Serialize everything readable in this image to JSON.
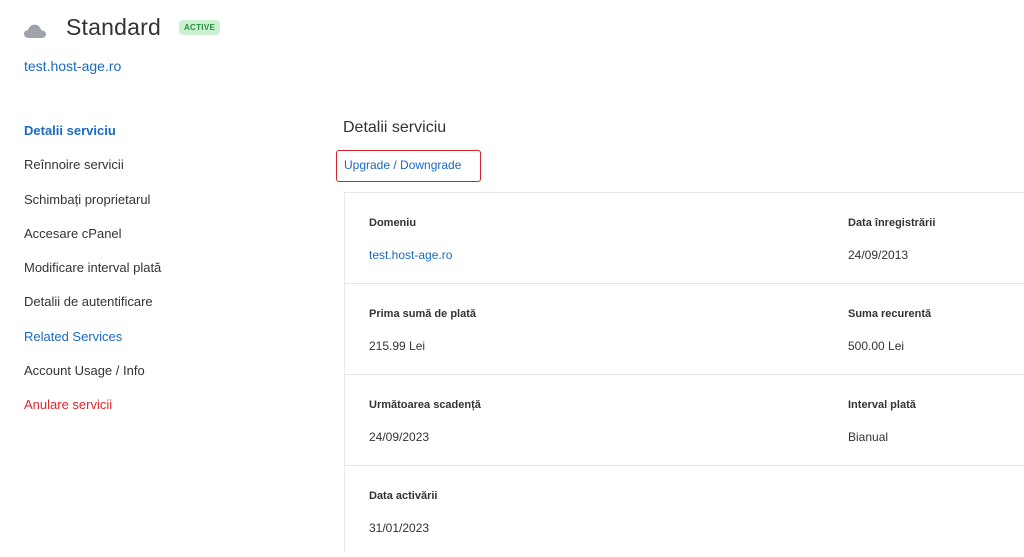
{
  "header": {
    "title": "Standard",
    "status": "ACTIVE",
    "domain": "test.host-age.ro",
    "icon": "cloud-icon"
  },
  "sidebar": {
    "items": [
      {
        "label": "Detalii serviciu"
      },
      {
        "label": "Reînnoire servicii"
      },
      {
        "label": "Schimbați proprietarul"
      },
      {
        "label": "Accesare cPanel"
      },
      {
        "label": "Modificare interval plată"
      },
      {
        "label": "Detalii de autentificare"
      },
      {
        "label": "Related Services"
      },
      {
        "label": "Account Usage / Info"
      },
      {
        "label": "Anulare servicii"
      }
    ]
  },
  "main": {
    "section_title": "Detalii serviciu",
    "upgrade_label": "Upgrade / Downgrade",
    "rows": [
      {
        "left": {
          "label": "Domeniu",
          "value": "test.host-age.ro"
        },
        "right": {
          "label": "Data înregistrării",
          "value": "24/09/2013"
        }
      },
      {
        "left": {
          "label": "Prima sumă de plată",
          "value": "215.99 Lei"
        },
        "right": {
          "label": "Suma recurentă",
          "value": "500.00 Lei"
        }
      },
      {
        "left": {
          "label": "Următoarea scadență",
          "value": "24/09/2023"
        },
        "right": {
          "label": "Interval plată",
          "value": "Bianual"
        }
      },
      {
        "left": {
          "label": "Data activării",
          "value": "31/01/2023"
        }
      }
    ]
  },
  "colors": {
    "link": "#1a6ac4",
    "danger": "#e0262f",
    "badge_bg": "#c9f0cf",
    "badge_text": "#2d8a3e",
    "highlight_border": "#d6222a"
  }
}
